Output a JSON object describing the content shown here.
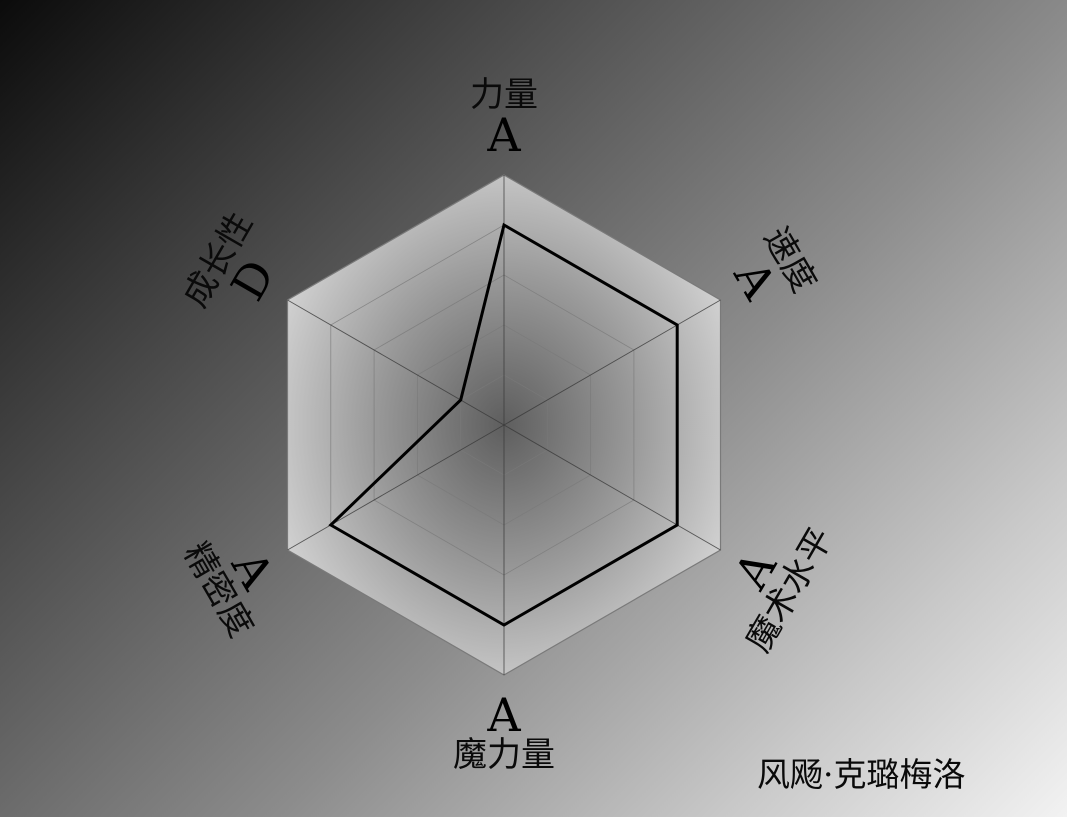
{
  "character_name": "风飏·克璐梅洛",
  "chart_data": {
    "type": "radar",
    "levels": 5,
    "max": 5,
    "axes": [
      {
        "label": "力量",
        "grade": "A",
        "value": 4
      },
      {
        "label": "速度",
        "grade": "A",
        "value": 4
      },
      {
        "label": "魔术水平",
        "grade": "A",
        "value": 4
      },
      {
        "label": "魔力量",
        "grade": "A",
        "value": 4
      },
      {
        "label": "精密度",
        "grade": "A",
        "value": 4
      },
      {
        "label": "成长性",
        "grade": "D",
        "value": 1
      }
    ],
    "colors": {
      "data_line": "#000000",
      "grid_line": "#7a7a7a",
      "fill_inner": "#5e5e5e",
      "fill_outer": "#cfcfcf"
    }
  }
}
